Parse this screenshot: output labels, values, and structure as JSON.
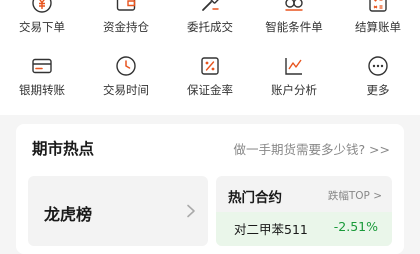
{
  "quick_actions": {
    "row1": [
      {
        "label": "交易下单",
        "icon": "yuan-order-icon"
      },
      {
        "label": "资金持仓",
        "icon": "wallet-icon"
      },
      {
        "label": "委托成交",
        "icon": "hammer-icon"
      },
      {
        "label": "智能条件单",
        "icon": "smart-condition-icon"
      },
      {
        "label": "结算账单",
        "icon": "calculator-icon"
      }
    ],
    "row2": [
      {
        "label": "银期转账",
        "icon": "bank-card-icon"
      },
      {
        "label": "交易时间",
        "icon": "clock-icon"
      },
      {
        "label": "保证金率",
        "icon": "percent-icon"
      },
      {
        "label": "账户分析",
        "icon": "chart-line-icon"
      },
      {
        "label": "更多",
        "icon": "more-dots-icon"
      }
    ]
  },
  "hot_section": {
    "title": "期市热点",
    "question_link": "做一手期货需要多少钱? >>",
    "dragon_tiger": {
      "label": "龙虎榜"
    },
    "hot_contracts": {
      "title": "热门合约",
      "sort_label": "跌幅TOP >",
      "rows": [
        {
          "name": "对二甲苯511",
          "change": "-2.51%"
        }
      ]
    }
  },
  "colors": {
    "accent": "#e8541e",
    "down": "#1a9a3a",
    "down_bg": "#eaf6ea"
  }
}
